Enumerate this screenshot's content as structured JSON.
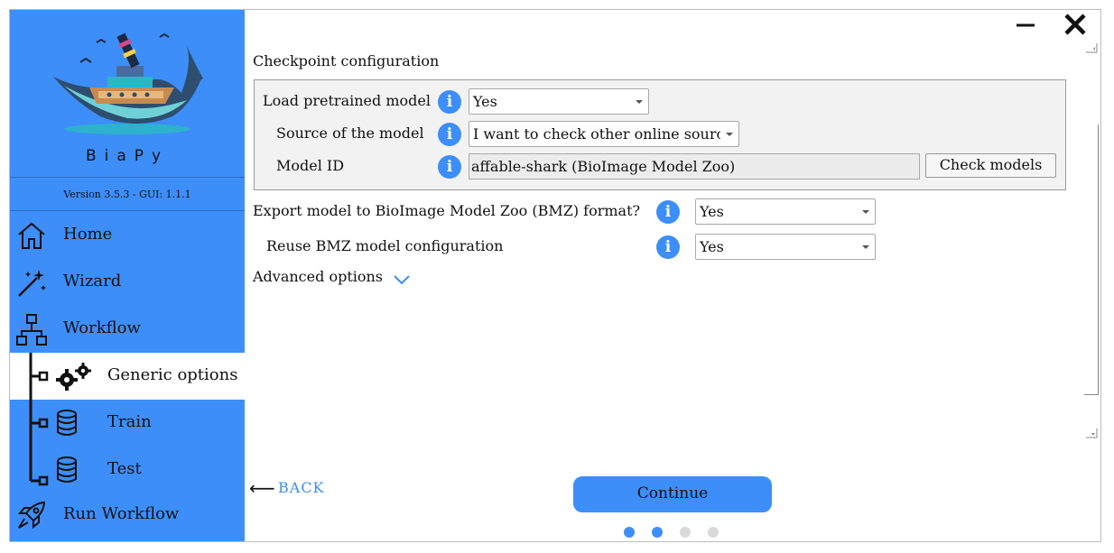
{
  "app": {
    "name": "BiaPy",
    "version": "Version 3.5.3 - GUI: 1.1.1"
  },
  "sidebar": {
    "items": [
      {
        "label": "Home",
        "icon": "home-icon"
      },
      {
        "label": "Wizard",
        "icon": "magic-wand-icon"
      },
      {
        "label": "Workflow",
        "icon": "workflow-icon"
      },
      {
        "label": "Generic options",
        "icon": "gears-icon",
        "active": true
      },
      {
        "label": "Train",
        "icon": "database-icon"
      },
      {
        "label": "Test",
        "icon": "database-icon"
      },
      {
        "label": "Run Workflow",
        "icon": "rocket-icon"
      }
    ]
  },
  "window": {
    "minimize_icon": "minimize-icon",
    "close_icon": "close-icon"
  },
  "checkpoint": {
    "section_title": "Checkpoint configuration",
    "load_pretrained": {
      "label": "Load pretrained model",
      "value": "Yes"
    },
    "source": {
      "label": "Source of the model",
      "value": "I want to check other online sources"
    },
    "model_id": {
      "label": "Model ID",
      "value": "affable-shark (BioImage Model Zoo)"
    },
    "check_models_label": "Check models"
  },
  "bmz": {
    "export": {
      "label": "Export model to BioImage Model Zoo (BMZ) format?",
      "value": "Yes"
    },
    "reuse": {
      "label": "Reuse BMZ model configuration",
      "value": "Yes"
    }
  },
  "advanced_options_label": "Advanced options",
  "navigation": {
    "back_label": "BACK",
    "continue_label": "Continue",
    "steps_total": 4,
    "steps_completed": 2
  },
  "colors": {
    "accent": "#3d8ef8",
    "dot_inactive": "#d9d9d9"
  }
}
